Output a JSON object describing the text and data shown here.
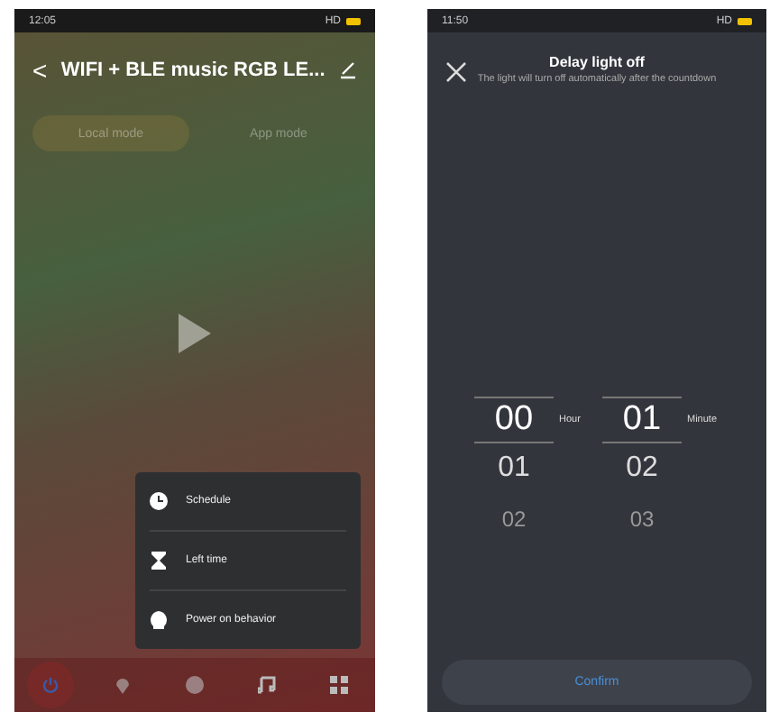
{
  "left_phone": {
    "status_bar": {
      "time": "12:05",
      "right": "HD"
    },
    "header": {
      "back": "<",
      "title": "WIFI + BLE music RGB LE..."
    },
    "mode_tabs": [
      {
        "label": "Local mode",
        "selected": true
      },
      {
        "label": "App mode",
        "selected": false
      }
    ],
    "popup_menu": [
      {
        "kind": "clock",
        "label": "Schedule"
      },
      {
        "kind": "hourglass",
        "label": "Left time"
      },
      {
        "kind": "bulb",
        "label": "Power on behavior"
      }
    ],
    "bottom_nav": [
      {
        "kind": "power",
        "selected": true
      },
      {
        "kind": "pin",
        "selected": false
      },
      {
        "kind": "palette",
        "selected": false
      },
      {
        "kind": "music",
        "selected": false
      },
      {
        "kind": "grid",
        "selected": false
      }
    ]
  },
  "right_phone": {
    "status_bar": {
      "time": "11:50",
      "right": "HD"
    },
    "title": "Delay light off",
    "subtitle": "The light will turn off automatically after the countdown",
    "pickers": [
      {
        "unit": "Hour",
        "values": [
          {
            "text": "00",
            "selected": true
          },
          {
            "text": "01",
            "selected": false
          },
          {
            "text": "02",
            "selected": false
          }
        ]
      },
      {
        "unit": "Minute",
        "values": [
          {
            "text": "01",
            "selected": true
          },
          {
            "text": "02",
            "selected": false
          },
          {
            "text": "03",
            "selected": false
          }
        ]
      }
    ],
    "confirm": "Confirm"
  }
}
